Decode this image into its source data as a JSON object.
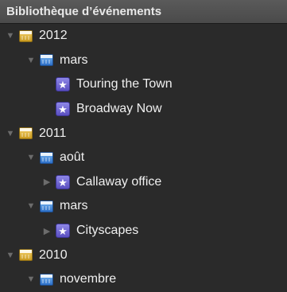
{
  "header": {
    "title": "Bibliothèque d’événements"
  },
  "tree": [
    {
      "label": "2012",
      "type": "year",
      "expanded": true
    },
    {
      "label": "mars",
      "type": "month",
      "expanded": true
    },
    {
      "label": "Touring the Town",
      "type": "event"
    },
    {
      "label": "Broadway Now",
      "type": "event"
    },
    {
      "label": "2011",
      "type": "year",
      "expanded": true
    },
    {
      "label": "août",
      "type": "month",
      "expanded": true
    },
    {
      "label": "Callaway office",
      "type": "event",
      "expanded": false
    },
    {
      "label": "mars",
      "type": "month",
      "expanded": true
    },
    {
      "label": "Cityscapes",
      "type": "event",
      "expanded": false
    },
    {
      "label": "2010",
      "type": "year",
      "expanded": true
    },
    {
      "label": "novembre",
      "type": "month",
      "expanded": true
    }
  ],
  "colors": {
    "background": "#2a2a2a",
    "year_icon": "#e0b33a",
    "month_icon": "#4a90e2",
    "event_icon": "#6f66d8"
  }
}
